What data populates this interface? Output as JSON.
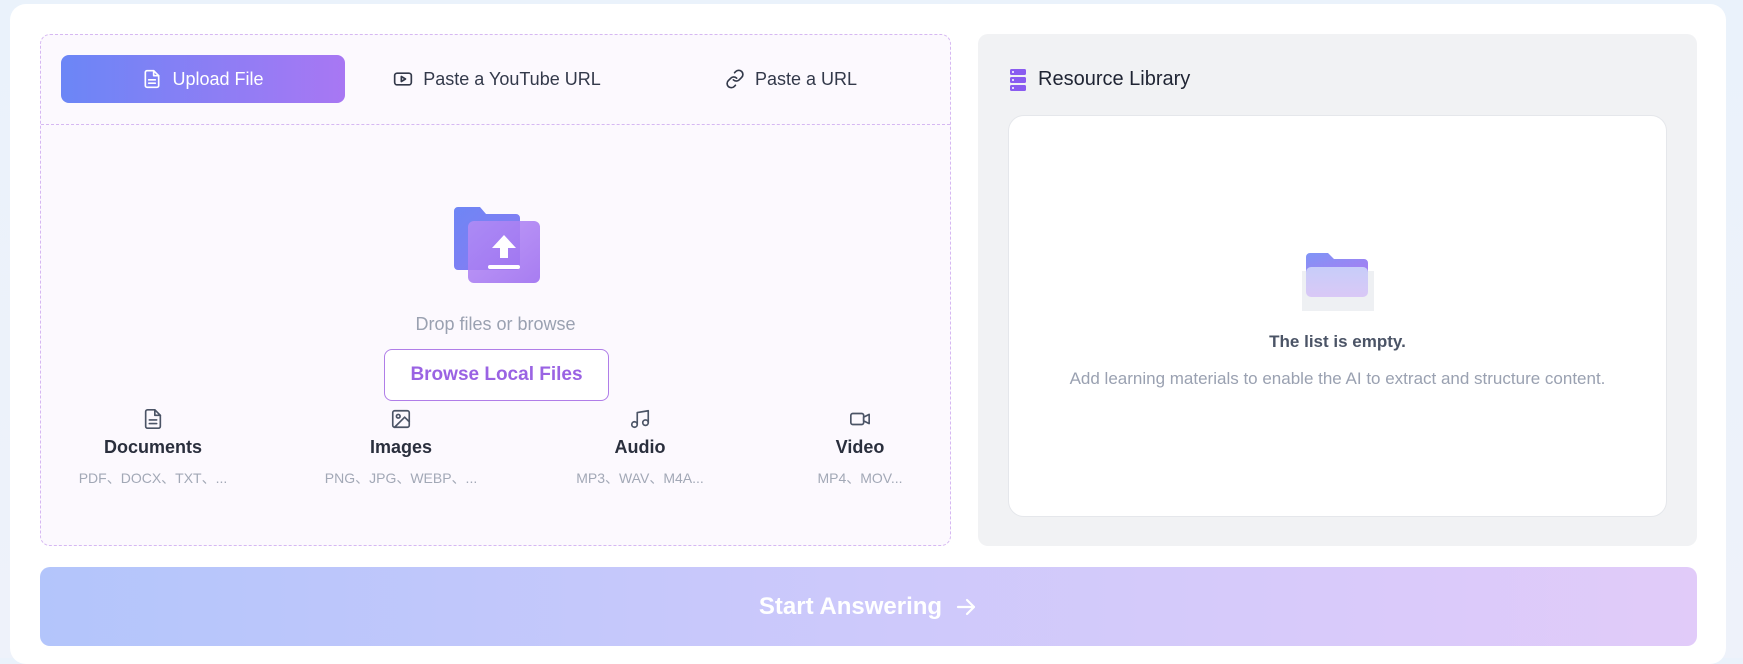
{
  "tabs": [
    {
      "label": "Upload File",
      "icon": "file-icon",
      "active": true
    },
    {
      "label": "Paste a YouTube URL",
      "icon": "youtube-icon",
      "active": false
    },
    {
      "label": "Paste a URL",
      "icon": "link-icon",
      "active": false
    }
  ],
  "drop": {
    "hint": "Drop files or browse",
    "browse_label": "Browse Local Files"
  },
  "file_types": [
    {
      "name": "Documents",
      "extensions": "PDF、DOCX、TXT、...",
      "icon": "document-icon"
    },
    {
      "name": "Images",
      "extensions": "PNG、JPG、WEBP、...",
      "icon": "image-icon"
    },
    {
      "name": "Audio",
      "extensions": "MP3、WAV、M4A...",
      "icon": "music-icon"
    },
    {
      "name": "Video",
      "extensions": "MP4、MOV...",
      "icon": "video-icon"
    }
  ],
  "library": {
    "title": "Resource Library",
    "empty_title": "The list is empty.",
    "empty_desc": "Add learning materials to enable the AI to extract and structure content."
  },
  "start": {
    "label": "Start Answering"
  },
  "colors": {
    "accent_start": "#6b86f6",
    "accent_end": "#a877f3",
    "dashed_border": "#d6b8f2",
    "browse_text": "#9a63e3"
  }
}
